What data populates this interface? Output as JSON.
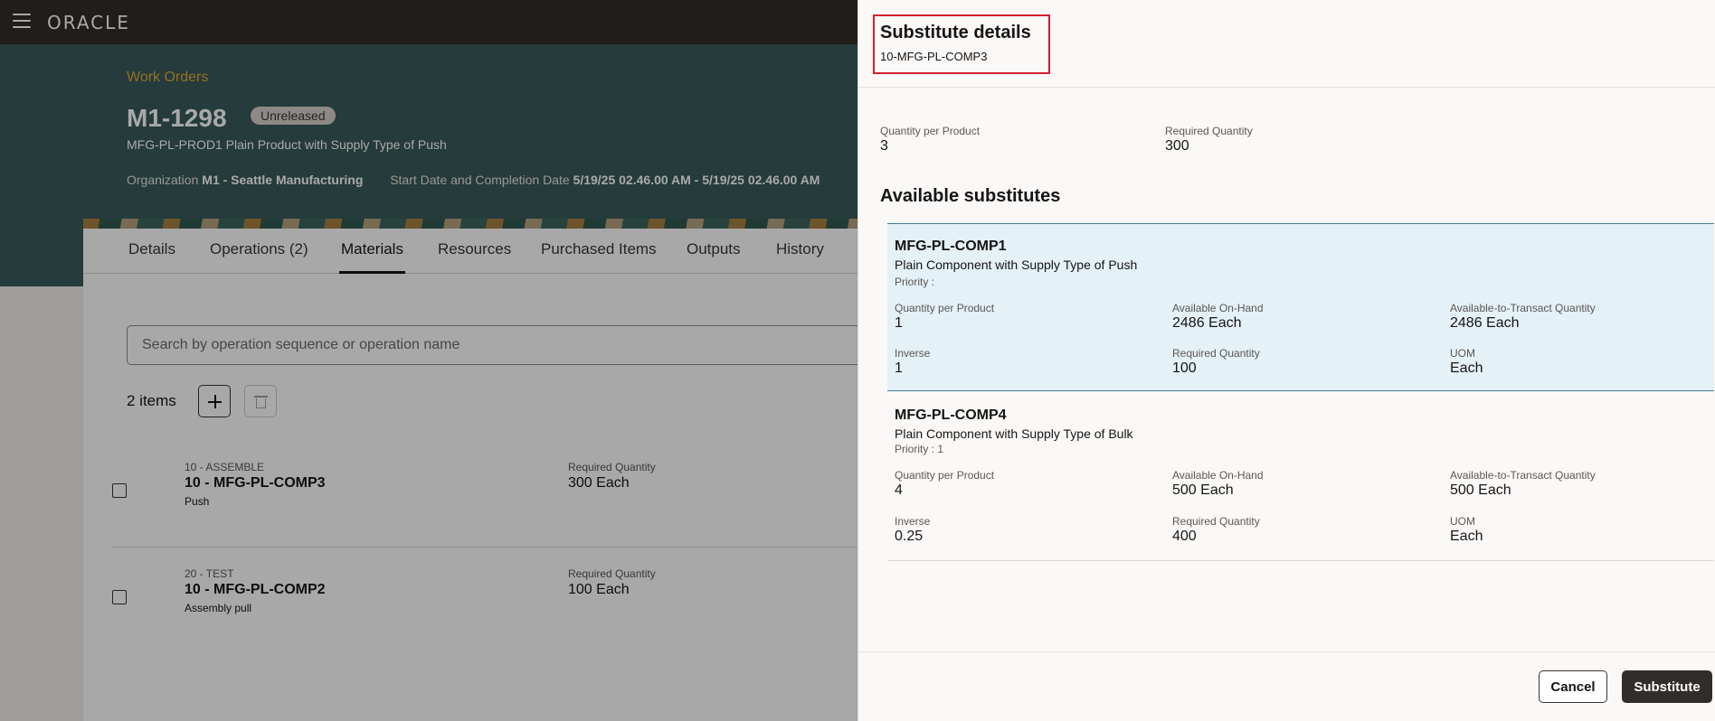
{
  "header": {
    "brand": "ORACLE"
  },
  "hero": {
    "breadcrumb": "Work Orders",
    "title": "M1-1298",
    "status": "Unreleased",
    "subtitle": "MFG-PL-PROD1 Plain Product with Supply Type of Push",
    "org_label": "Organization",
    "org_value": "M1 - Seattle Manufacturing",
    "dates_label": "Start Date and Completion Date",
    "dates_value": "5/19/25 02.46.00 AM - 5/19/25 02.46.00 AM"
  },
  "tabs": [
    "Details",
    "Operations (2)",
    "Materials",
    "Resources",
    "Purchased Items",
    "Outputs",
    "History"
  ],
  "materials": {
    "search_placeholder": "Search by operation sequence or operation name",
    "items_count": "2 items",
    "rows": [
      {
        "operation": "10 - ASSEMBLE",
        "component": "10 - MFG-PL-COMP3",
        "supply": "Push",
        "rq_label": "Required Quantity",
        "rq_value": "300 Each"
      },
      {
        "operation": "20 - TEST",
        "component": "10 - MFG-PL-COMP2",
        "supply": "Assembly pull",
        "rq_label": "Required Quantity",
        "rq_value": "100 Each"
      }
    ]
  },
  "drawer": {
    "title": "Substitute details",
    "subtitle": "10-MFG-PL-COMP3",
    "qpp_label": "Quantity per Product",
    "qpp_value": "3",
    "rq_label": "Required Quantity",
    "rq_value": "300",
    "available_title": "Available substitutes",
    "substitutes": [
      {
        "name": "MFG-PL-COMP1",
        "description": "Plain Component with Supply Type of Push",
        "priority": "Priority :",
        "fields": [
          {
            "label": "Quantity per Product",
            "value": "1"
          },
          {
            "label": "Available On-Hand",
            "value": "2486 Each"
          },
          {
            "label": "Available-to-Transact Quantity",
            "value": "2486 Each"
          },
          {
            "label": "Inverse",
            "value": "1"
          },
          {
            "label": "Required Quantity",
            "value": "100"
          },
          {
            "label": "UOM",
            "value": "Each"
          }
        ]
      },
      {
        "name": "MFG-PL-COMP4",
        "description": "Plain Component with Supply Type of Bulk",
        "priority": "Priority : 1",
        "fields": [
          {
            "label": "Quantity per Product",
            "value": "4"
          },
          {
            "label": "Available On-Hand",
            "value": "500 Each"
          },
          {
            "label": "Available-to-Transact Quantity",
            "value": "500 Each"
          },
          {
            "label": "Inverse",
            "value": "0.25"
          },
          {
            "label": "Required Quantity",
            "value": "400"
          },
          {
            "label": "UOM",
            "value": "Each"
          }
        ]
      }
    ],
    "cancel_label": "Cancel",
    "substitute_label": "Substitute"
  }
}
